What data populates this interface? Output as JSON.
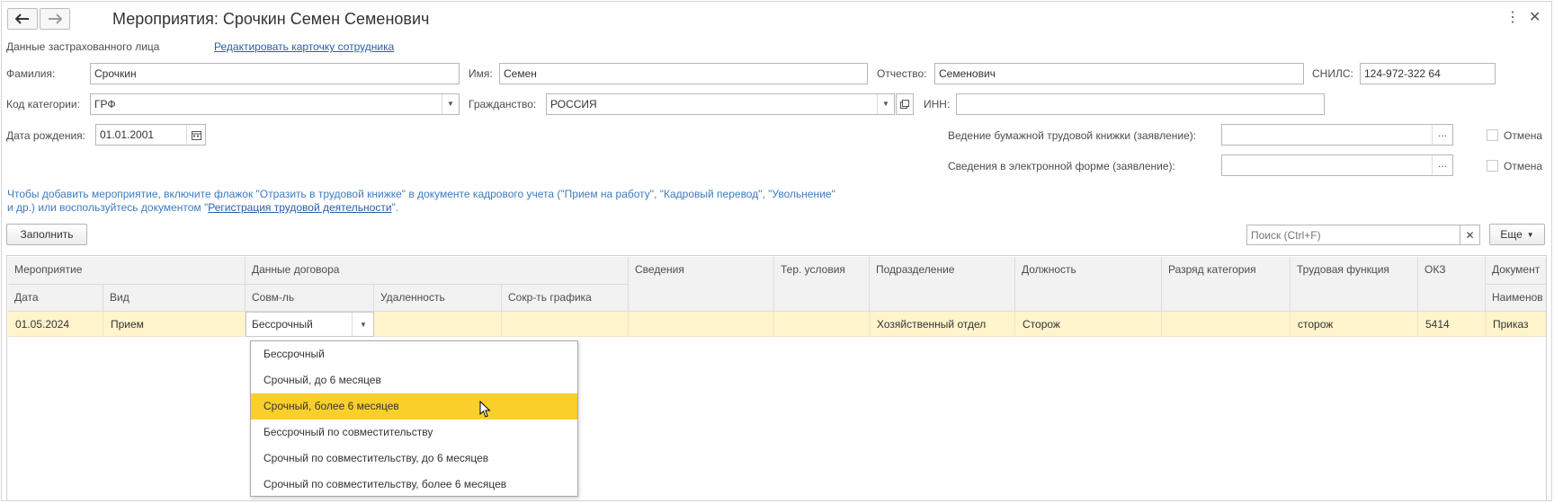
{
  "window": {
    "title": "Мероприятия: Срочкин Семен Семенович"
  },
  "insured": {
    "section_label": "Данные застрахованного лица",
    "edit_link": "Редактировать карточку сотрудника"
  },
  "fields": {
    "last_name": {
      "label": "Фамилия:",
      "value": "Срочкин"
    },
    "first_name": {
      "label": "Имя:",
      "value": "Семен"
    },
    "patronymic": {
      "label": "Отчество:",
      "value": "Семенович"
    },
    "snils": {
      "label": "СНИЛС:",
      "value": "124-972-322 64"
    },
    "category": {
      "label": "Код категории:",
      "value": "ГРФ"
    },
    "citizenship": {
      "label": "Гражданство:",
      "value": "РОССИЯ"
    },
    "inn": {
      "label": "ИНН:",
      "value": ""
    },
    "birth_date": {
      "label": "Дата рождения:",
      "value": "01.01.2001"
    },
    "paper_book": {
      "label": "Ведение бумажной трудовой книжки (заявление):",
      "value": "",
      "cancel": "Отмена"
    },
    "electronic": {
      "label": "Сведения в электронной форме (заявление):",
      "value": "",
      "cancel": "Отмена"
    }
  },
  "info": {
    "line1": "Чтобы добавить мероприятие, включите флажок \"Отразить в трудовой книжке\" в документе кадрового учета (\"Прием на работу\", \"Кадровый перевод\", \"Увольнение\"",
    "line2_prefix": "и др.) или воспользуйтесь документом \"",
    "line2_link": "Регистрация трудовой деятельности",
    "line2_suffix": "\"."
  },
  "toolbar": {
    "fill_button": "Заполнить",
    "search_placeholder": "Поиск (Ctrl+F)",
    "more_button": "Еще"
  },
  "table": {
    "headers": {
      "event": "Мероприятие",
      "contract": "Данные договора",
      "info": "Сведения",
      "ter": "Тер. условия",
      "division": "Подразделение",
      "position": "Должность",
      "grade": "Разряд категория",
      "function": "Трудовая функция",
      "okz": "ОКЗ",
      "document": "Документ"
    },
    "subheaders": {
      "date": "Дата",
      "kind": "Вид",
      "combination": "Совм-ль",
      "remoteness": "Удаленность",
      "reduction": "Сокр-ть графика",
      "doc_name": "Наименов"
    },
    "row": {
      "date": "01.05.2024",
      "kind": "Прием",
      "combination": "Бессрочный",
      "remoteness": "",
      "reduction": "",
      "info": "",
      "ter": "",
      "division": "Хозяйственный отдел",
      "position": "Сторож",
      "grade": "",
      "function": "сторож",
      "okz": "5414",
      "document": "Приказ"
    }
  },
  "dropdown": {
    "options": [
      "Бессрочный",
      "Срочный, до 6 месяцев",
      "Срочный, более 6 месяцев",
      "Бессрочный по совместительству",
      "Срочный по совместительству, до 6 месяцев",
      "Срочный по совместительству, более 6 месяцев"
    ],
    "selected_index": 2
  },
  "colors": {
    "link": "#2a5fa8",
    "info_text": "#3d7bbf",
    "selected_row": "#fff4cc",
    "highlight": "#fbcf29"
  }
}
